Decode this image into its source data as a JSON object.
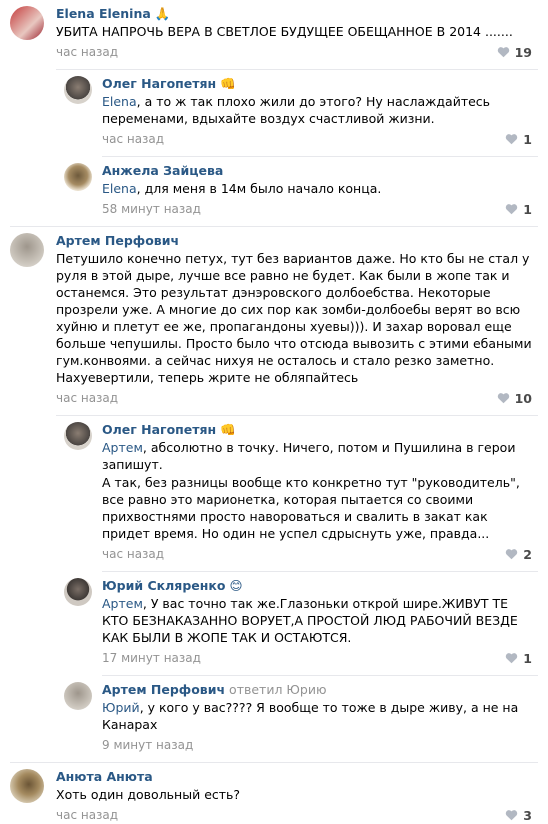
{
  "colors": {
    "link": "#2a5885",
    "meta": "#939393",
    "separator": "#e7e8ec",
    "like_icon": "#b2b8c2"
  },
  "comments": [
    {
      "author": "Elena Elenina",
      "emoji": "🙏",
      "text": "УБИТА НАПРОЧЬ ВЕРА В СВЕТЛОЕ БУДУЩЕЕ ОБЕЩАННОЕ В 2014 .......",
      "time": "час назад",
      "likes": "19"
    },
    {
      "author": "Олег Нагопетян",
      "emoji": "👊",
      "mention": "Elena",
      "text": ", а то ж так плохо жили до этого? Ну наслаждайтесь переменами, вдыхайте воздух счастливой жизни.",
      "time": "час назад",
      "likes": "1"
    },
    {
      "author": "Анжела Зайцева",
      "mention": "Elena",
      "text": ", для меня в 14м было начало конца.",
      "time": "58 минут назад",
      "likes": "1"
    },
    {
      "author": "Артем Перфович",
      "text": "Петушило конечно петух, тут без вариантов даже. Но кто бы не стал у руля в этой дыре, лучше все равно не будет. Как были в жопе так и останемся. Это результат дэнэровского долбоебства. Некоторые прозрели уже. А многие до сих пор как зомби-долбоебы верят во всю хуйню и плетут ее же, пропагандоны хуевы))). И захар воровал еще больше чепушилы. Просто было что отсюда вывозить с этими ебаными гум.конвоями. а сейчас нихуя не осталось и стало резко заметно. Нахуевертили, теперь жрите не обляпайтесь",
      "time": "час назад",
      "likes": "10"
    },
    {
      "author": "Олег Нагопетян",
      "emoji": "👊",
      "mention": "Артем",
      "text": ", абсолютно в точку. Ничего, потом и Пушилина в герои запишут.",
      "text2": "А так, без разницы вообще кто конкретно тут \"руководитель\", все равно это марионетка, которая пытается со своими прихвостнями просто навороваться и свалить в закат как придет время. Но один не успел сдрыснуть уже, правда...",
      "time": "час назад",
      "likes": "2"
    },
    {
      "author": "Юрий Скляренко",
      "emoji": "😊",
      "mention": "Артем",
      "text": ", У вас точно так же.Глазоньки открой шире.ЖИВУТ ТЕ КТО БЕЗНАКАЗАННО ВОРУЕТ,А ПРОСТОЙ ЛЮД РАБОЧИЙ ВЕЗДЕ КАК БЫЛИ В ЖОПЕ ТАК И ОСТАЮТСЯ.",
      "time": "17 минут назад",
      "likes": "1"
    },
    {
      "author": "Артем Перфович",
      "replied": "ответил Юрию",
      "mention": "Юрий",
      "text": ", у кого у вас???? Я вообще то тоже в дыре живу, а не на Канарах",
      "time": "9 минут назад",
      "likes": ""
    },
    {
      "author": "Анюта Анюта",
      "text": "Хоть один довольный есть?",
      "time": "час назад",
      "likes": "3"
    }
  ]
}
